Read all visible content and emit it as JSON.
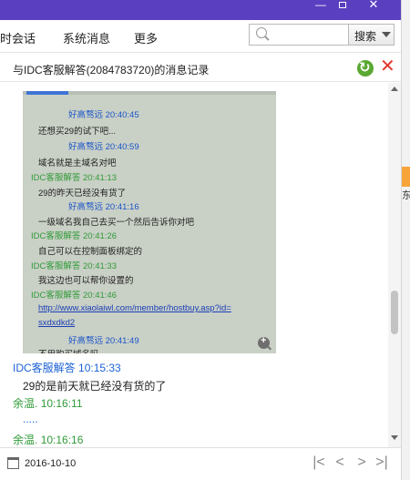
{
  "tabs": [
    "时会话",
    "系统消息",
    "更多"
  ],
  "search": {
    "button_label": "搜索",
    "placeholder": ""
  },
  "record_title": "与IDC客服解答(2084783720)的消息记录",
  "embedded": [
    {
      "kind": "meta-blue",
      "text": "好高骛远 20:40:45"
    },
    {
      "kind": "msg",
      "text": "还想买29的试下吧..."
    },
    {
      "kind": "meta-blue",
      "text": "好高骛远 20:40:59"
    },
    {
      "kind": "msg",
      "text": "域名就是主域名对吧"
    },
    {
      "kind": "meta-green",
      "text": "IDC客服解答 20:41:13"
    },
    {
      "kind": "msg",
      "text": "29的昨天已经没有货了"
    },
    {
      "kind": "meta-blue",
      "text": "好高骛远 20:41:16"
    },
    {
      "kind": "msg",
      "text": "一级域名我自己去买一个然后告诉你对吧"
    },
    {
      "kind": "meta-green",
      "text": "IDC客服解答 20:41:26"
    },
    {
      "kind": "msg",
      "text": "自己可以在控制面板绑定的"
    },
    {
      "kind": "meta-green",
      "text": "IDC客服解答 20:41:33"
    },
    {
      "kind": "msg",
      "text": "我这边也可以帮你设置的"
    },
    {
      "kind": "meta-green",
      "text": "IDC客服解答 20:41:46"
    },
    {
      "kind": "link",
      "text": "http://www.xiaolaiwl.com/member/hostbuy.asp?id="
    },
    {
      "kind": "link",
      "text": "sxdxdkd2"
    },
    {
      "kind": "meta-blue",
      "text": "好高骛远 20:41:49"
    },
    {
      "kind": "msg",
      "text": "不用购买域名吗"
    }
  ],
  "messages": [
    {
      "sender": "IDC客服解答",
      "time": "10:15:33",
      "color": "#1c63d6",
      "text": "29的是前天就已经没有货的了"
    },
    {
      "sender": "余温.",
      "time": "10:16:11",
      "color": "#2f9a37",
      "text": "....."
    },
    {
      "sender": "余温.",
      "time": "10:16:16",
      "color": "#2f9a37",
      "text": ""
    }
  ],
  "footer": {
    "date": "2016-10-10"
  },
  "side_char": "东"
}
